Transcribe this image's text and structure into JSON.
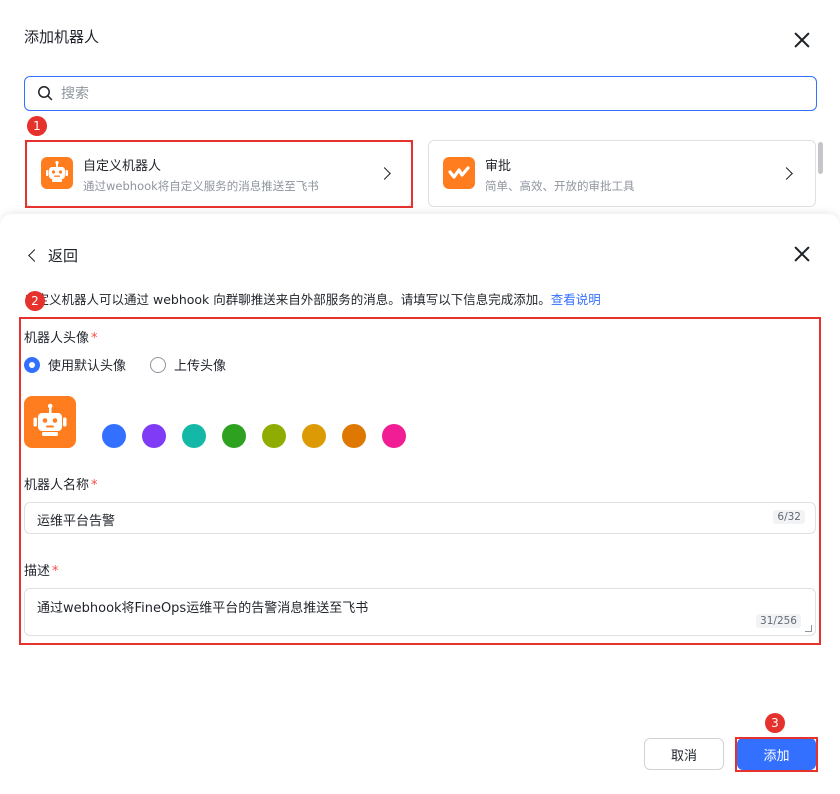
{
  "top_panel": {
    "title": "添加机器人",
    "search": {
      "placeholder": "搜索",
      "value": ""
    },
    "cards": [
      {
        "title": "自定义机器人",
        "description": "通过webhook将自定义服务的消息推送至飞书",
        "icon": "robot-icon"
      },
      {
        "title": "审批",
        "description": "简单、高效、开放的审批工具",
        "icon": "approval-icon"
      }
    ]
  },
  "dialog": {
    "back_label": "返回",
    "intro_text": "自定义机器人可以通过 webhook 向群聊推送来自外部服务的消息。请填写以下信息完成添加。",
    "intro_link": "查看说明",
    "avatar_label": "机器人头像",
    "avatar_options": [
      {
        "label": "使用默认头像",
        "checked": true
      },
      {
        "label": "上传头像",
        "checked": false
      }
    ],
    "avatar_icon": "robot-icon",
    "avatar_color": "#ff7d1f",
    "swatch_colors": [
      "#3370ff",
      "#7f3bf5",
      "#14b8a6",
      "#2ea121",
      "#8fac02",
      "#dc9b04",
      "#de7802",
      "#f01d94"
    ],
    "name_label": "机器人名称",
    "name_value": "运维平台告警",
    "name_counter": "6/32",
    "desc_label": "描述",
    "desc_value": "通过webhook将FineOps运维平台的告警消息推送至飞书",
    "desc_counter": "31/256",
    "required_mark": "*",
    "cancel_label": "取消",
    "add_label": "添加"
  },
  "annotations": [
    "1",
    "2",
    "3"
  ],
  "colors": {
    "accent": "#3370ff",
    "annotation": "#e5322d",
    "robot_orange": "#ff7d1f"
  }
}
